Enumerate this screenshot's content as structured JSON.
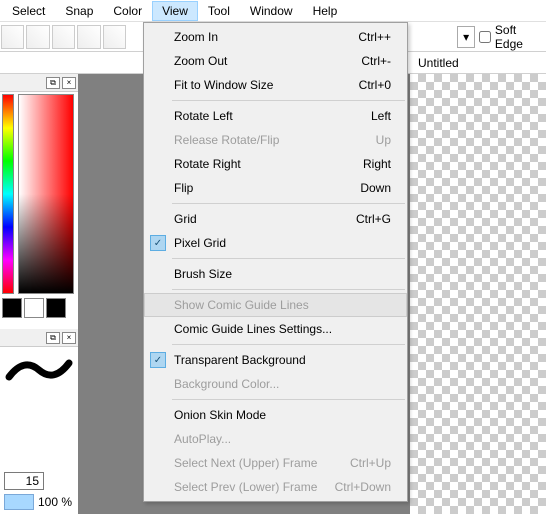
{
  "menubar": {
    "items": [
      "Select",
      "Snap",
      "Color",
      "View",
      "Tool",
      "Window",
      "Help"
    ],
    "activeIndex": 3
  },
  "toolbar": {
    "softEdgeLabel": "Soft Edge"
  },
  "tabs": {
    "untitled": "Untitled"
  },
  "viewMenu": [
    {
      "label": "Zoom In",
      "shortcut": "Ctrl++"
    },
    {
      "label": "Zoom Out",
      "shortcut": "Ctrl+-"
    },
    {
      "label": "Fit to Window Size",
      "shortcut": "Ctrl+0"
    },
    {
      "sep": true
    },
    {
      "label": "Rotate Left",
      "shortcut": "Left"
    },
    {
      "label": "Release Rotate/Flip",
      "shortcut": "Up",
      "disabled": true
    },
    {
      "label": "Rotate Right",
      "shortcut": "Right"
    },
    {
      "label": "Flip",
      "shortcut": "Down"
    },
    {
      "sep": true
    },
    {
      "label": "Grid",
      "shortcut": "Ctrl+G"
    },
    {
      "label": "Pixel Grid",
      "checked": true
    },
    {
      "sep": true
    },
    {
      "label": "Brush Size"
    },
    {
      "sep": true
    },
    {
      "label": "Show Comic Guide Lines",
      "disabled": true,
      "hovered": true
    },
    {
      "label": "Comic Guide Lines Settings..."
    },
    {
      "sep": true
    },
    {
      "label": "Transparent Background",
      "checked": true
    },
    {
      "label": "Background Color...",
      "disabled": true
    },
    {
      "sep": true
    },
    {
      "label": "Onion Skin Mode"
    },
    {
      "label": "AutoPlay...",
      "disabled": true
    },
    {
      "label": "Select Next (Upper) Frame",
      "shortcut": "Ctrl+Up",
      "disabled": true
    },
    {
      "label": "Select Prev (Lower) Frame",
      "shortcut": "Ctrl+Down",
      "disabled": true
    }
  ],
  "brush": {
    "size": "15",
    "opacity": "100 %"
  },
  "colors": {
    "primary": "#000000",
    "secondary": "#ffffff",
    "third": "#000000"
  }
}
